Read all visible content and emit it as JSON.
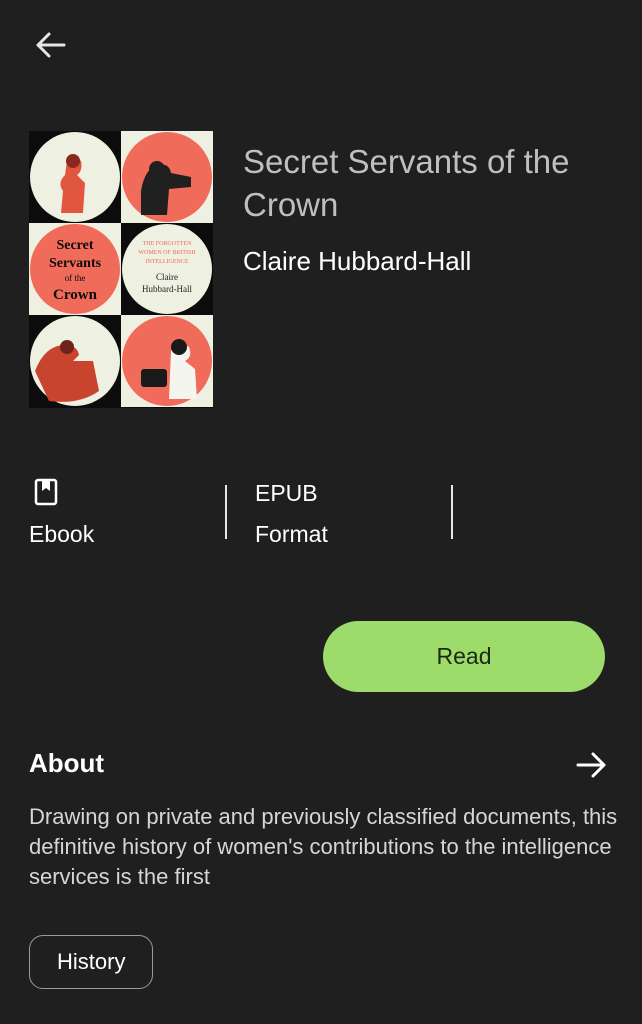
{
  "nav": {
    "back_icon": "arrow-left-icon"
  },
  "book": {
    "title": "Secret Servants of the Crown",
    "author": "Claire Hubbard-Hall",
    "cover": {
      "title_lines": [
        "Secret",
        "Servants",
        "of the",
        "Crown"
      ],
      "subtitle_lines": [
        "THE FORGOTTEN",
        "WOMEN OF BRITISH",
        "INTELLIGENCE"
      ],
      "author_lines": [
        "Claire",
        "Hubbard-Hall"
      ],
      "colors": {
        "coral": "#f06b5a",
        "cream": "#eef0e2",
        "dark": "#0c0c0c"
      }
    }
  },
  "stats": [
    {
      "icon": "book-bookmark-icon",
      "label": "Ebook"
    },
    {
      "top": "EPUB",
      "label": "Format"
    }
  ],
  "actions": {
    "read_label": "Read",
    "read_color": "#9ddc6b"
  },
  "about": {
    "title": "About",
    "arrow_icon": "arrow-right-icon",
    "description": "Drawing on private and previously classified documents, this definitive history of women's contributions to the intelligence services is the first"
  },
  "tags": [
    "History"
  ]
}
